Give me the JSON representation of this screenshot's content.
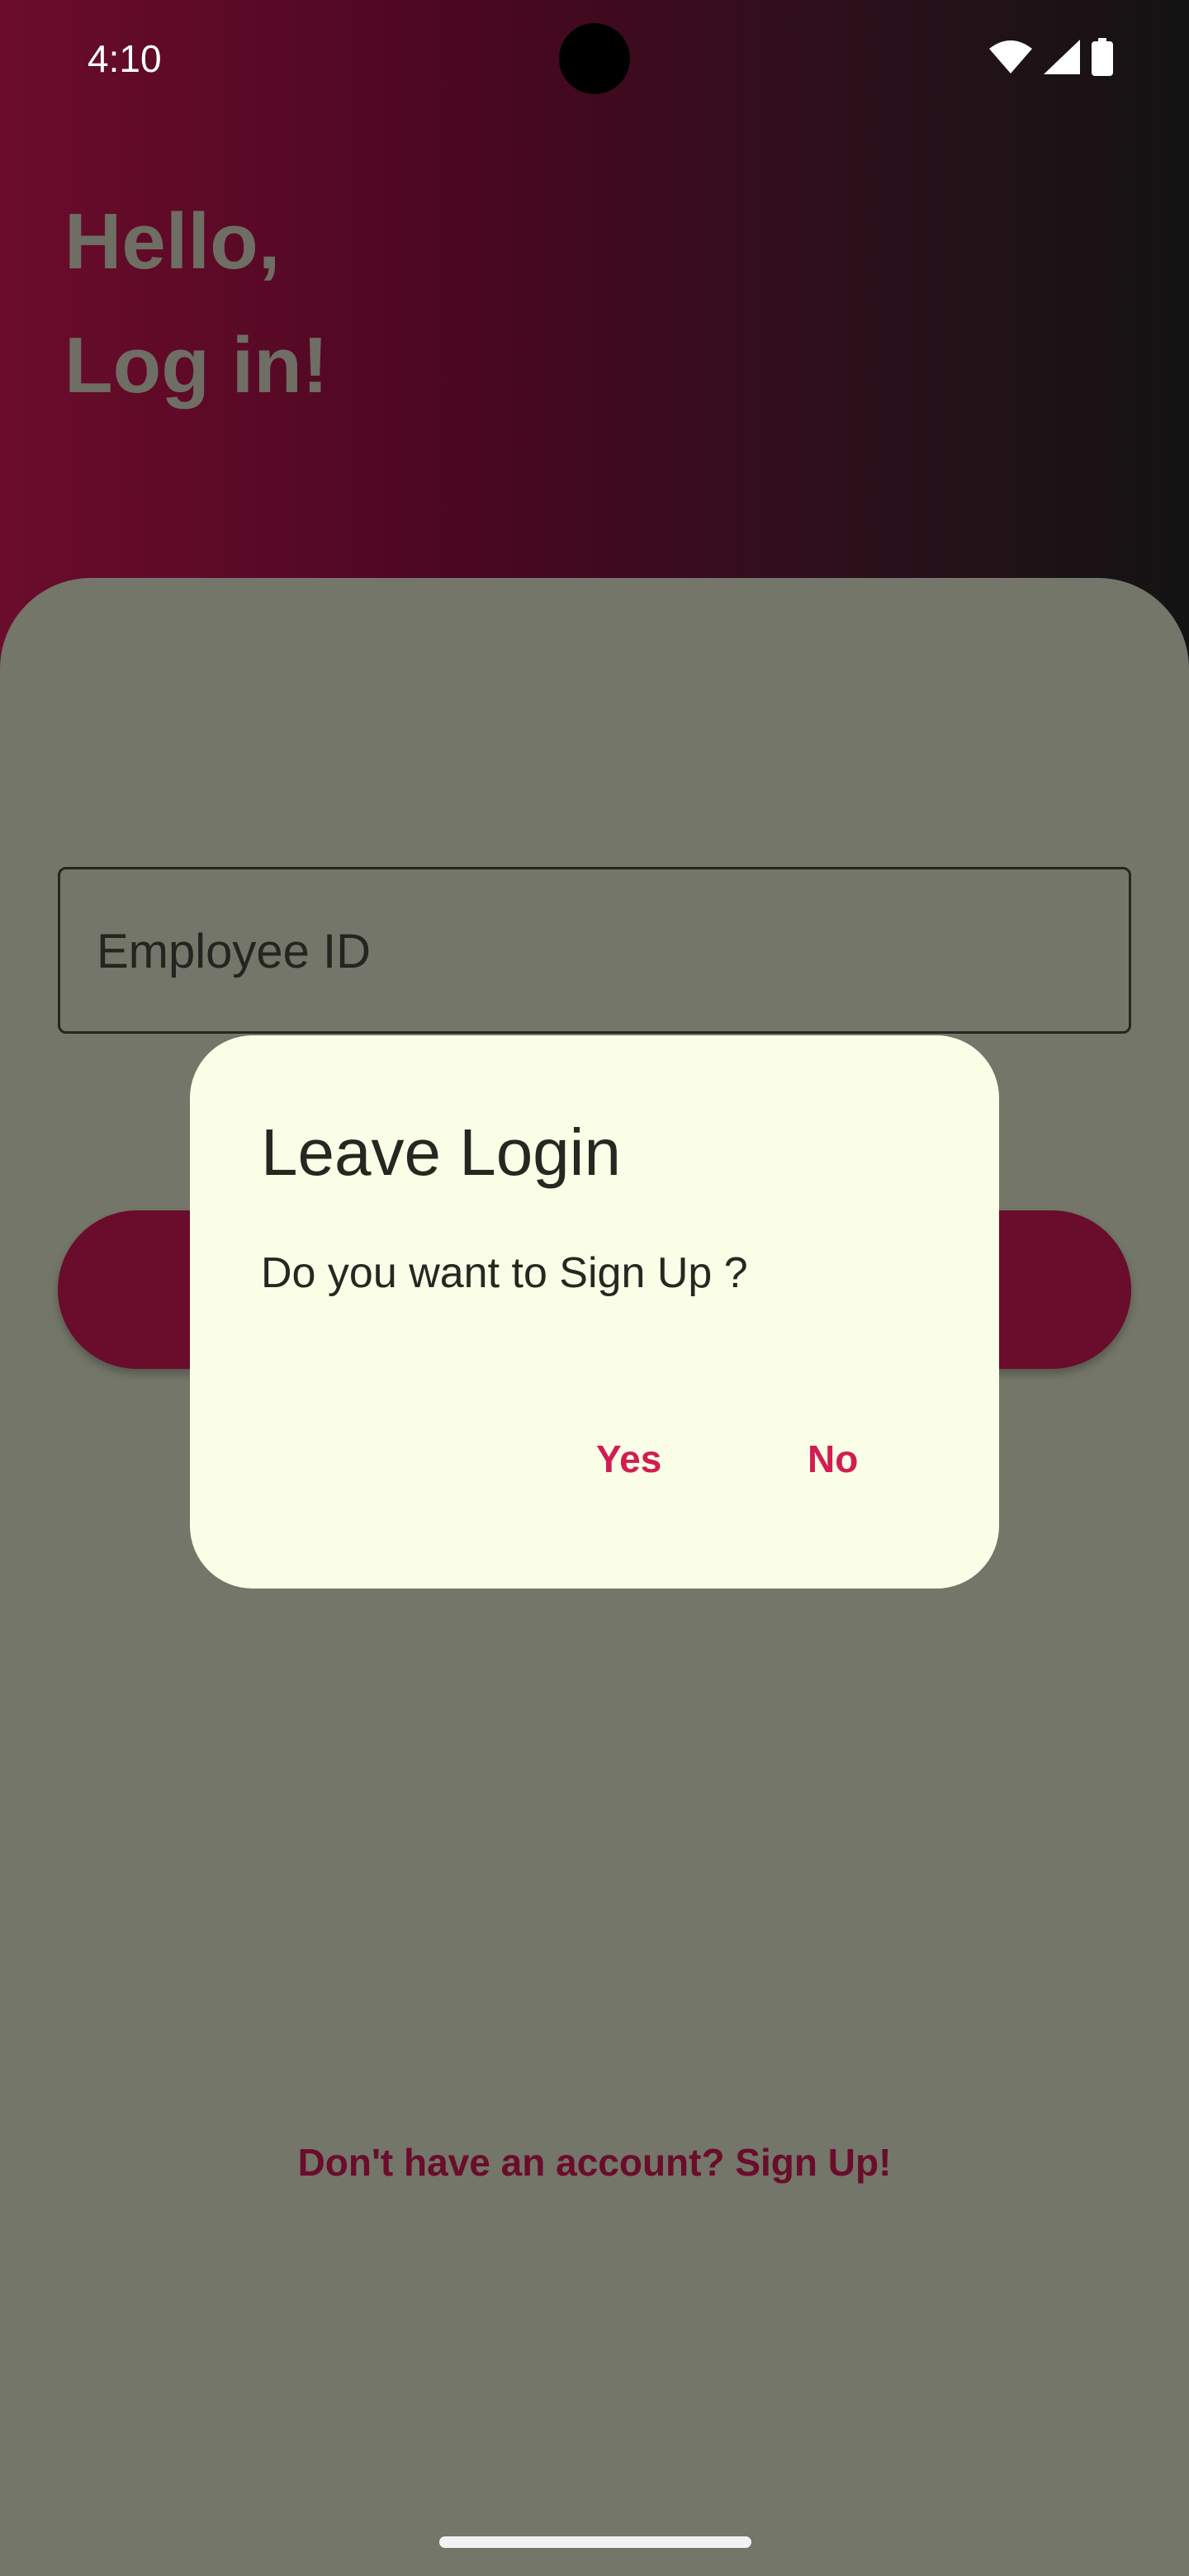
{
  "status_bar": {
    "time": "4:10",
    "icons": [
      "wifi-icon",
      "cellular-signal-icon",
      "battery-icon"
    ]
  },
  "header": {
    "greeting_line1": "Hello,",
    "greeting_line2": "Log in!"
  },
  "form": {
    "employee_id_placeholder": "Employee ID",
    "signup_link": "Don't have an account? Sign Up!"
  },
  "dialog": {
    "title": "Leave Login",
    "message": "Do you want to Sign Up ?",
    "yes_label": "Yes",
    "no_label": "No"
  },
  "colors": {
    "brand": "#6a0c2b",
    "dialog_background": "#fbfee6",
    "dialog_action": "#d21c52",
    "scrim": "#737668"
  }
}
